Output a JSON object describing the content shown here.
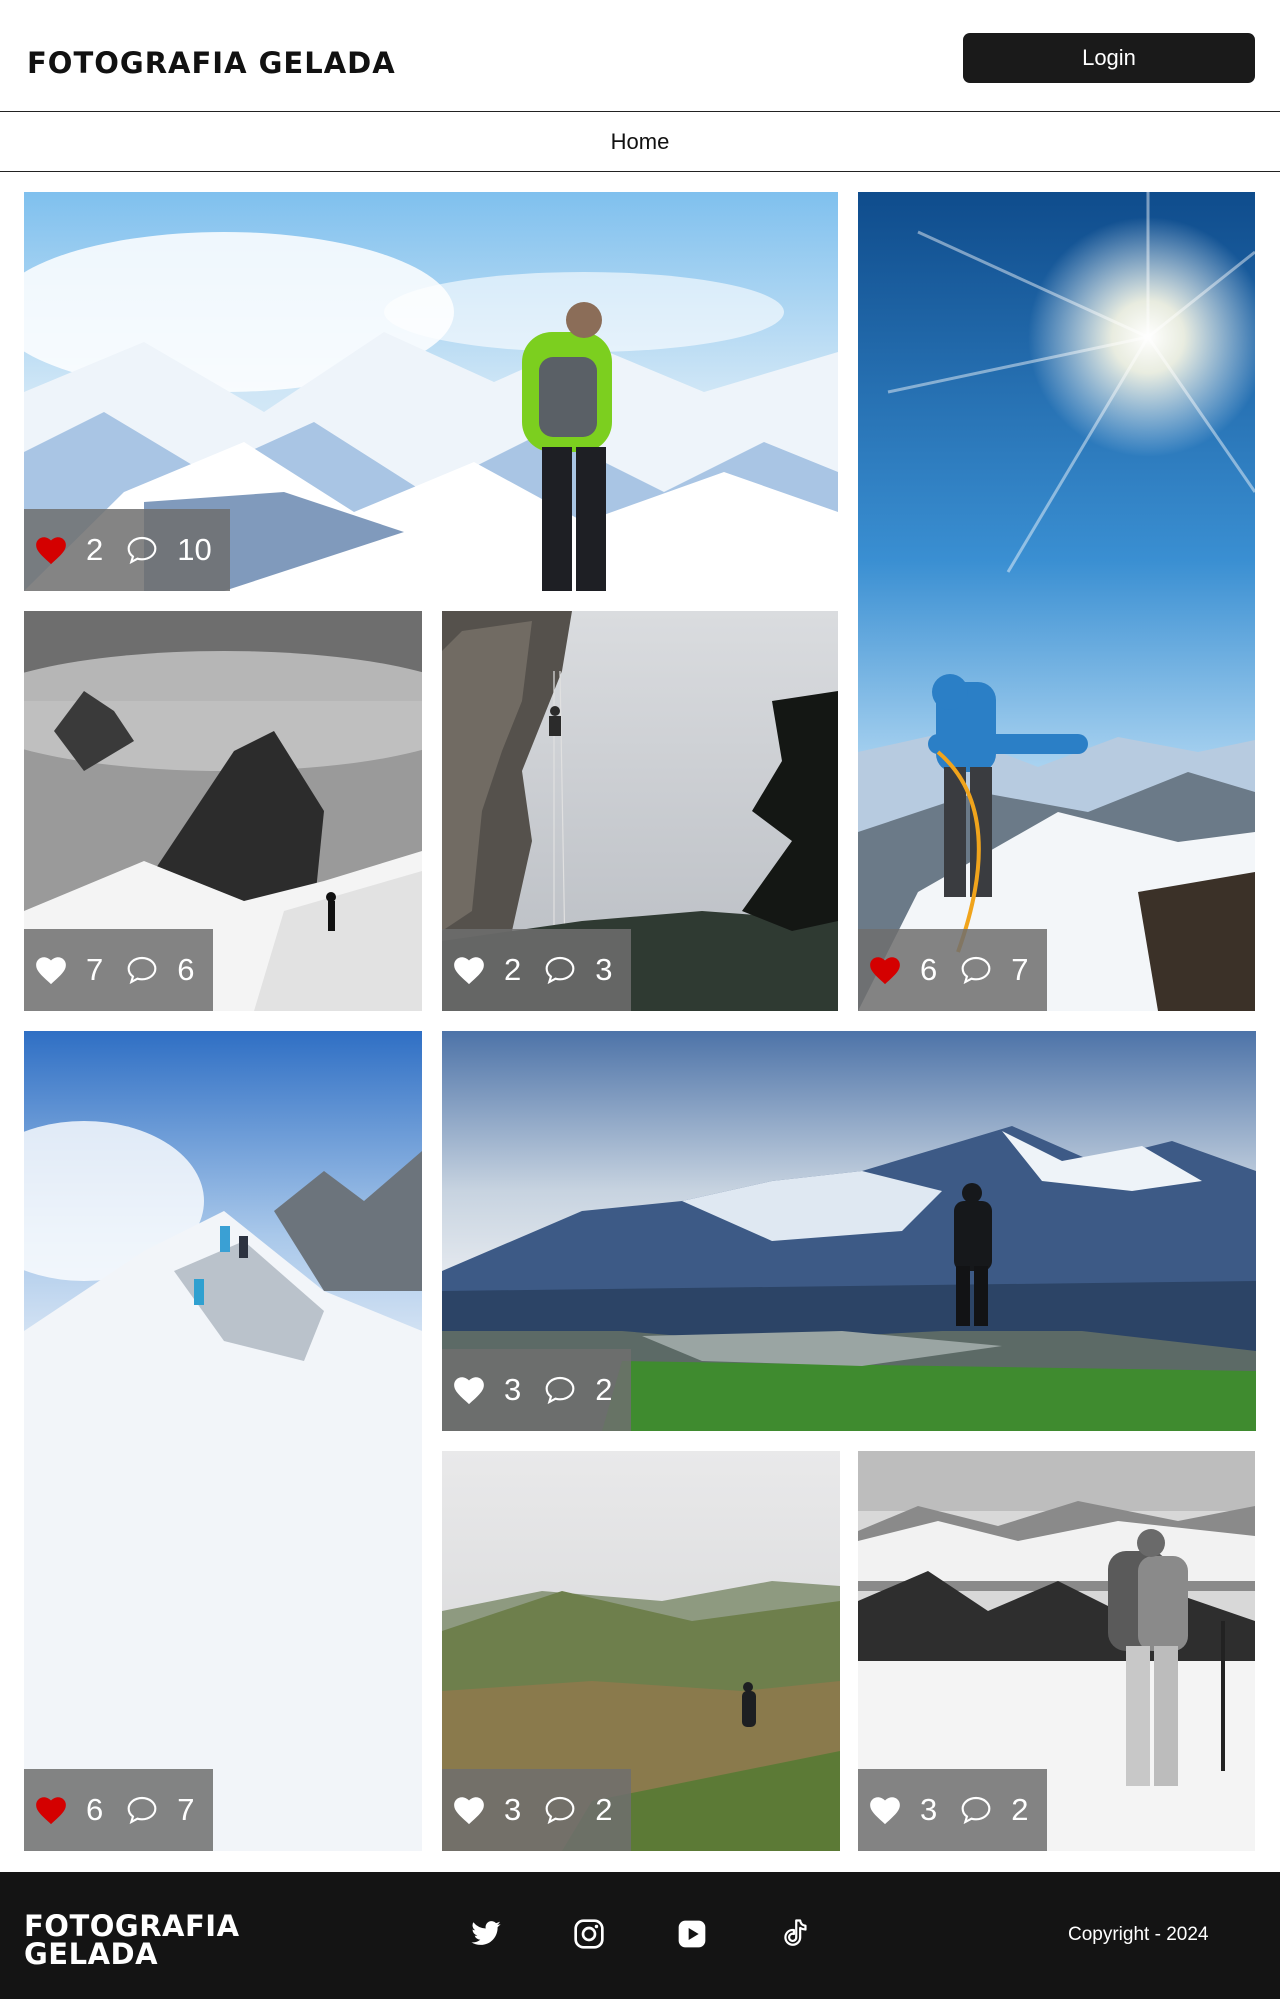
{
  "header": {
    "logo": "FOTOGRAFIA GELADA",
    "login_label": "Login"
  },
  "nav": {
    "home_label": "Home"
  },
  "photos": [
    {
      "liked": true,
      "likes": "2",
      "comments": "10"
    },
    {
      "liked": true,
      "likes": "6",
      "comments": "7"
    },
    {
      "liked": false,
      "likes": "7",
      "comments": "6"
    },
    {
      "liked": false,
      "likes": "2",
      "comments": "3"
    },
    {
      "liked": true,
      "likes": "6",
      "comments": "7"
    },
    {
      "liked": false,
      "likes": "3",
      "comments": "2"
    },
    {
      "liked": false,
      "likes": "3",
      "comments": "2"
    },
    {
      "liked": false,
      "likes": "3",
      "comments": "2"
    }
  ],
  "footer": {
    "logo_line1": "FOTOGRAFIA",
    "logo_line2": "GELADA",
    "social": [
      "twitter-icon",
      "instagram-icon",
      "youtube-icon",
      "tiktok-icon"
    ],
    "copyright": "Copyright - 2024"
  },
  "colors": {
    "heart_liked": "#d40000",
    "heart_default": "#ffffff",
    "stats_overlay": "#6e6e6e",
    "footer_bg": "#141414",
    "button_bg": "#1a1a1a"
  }
}
